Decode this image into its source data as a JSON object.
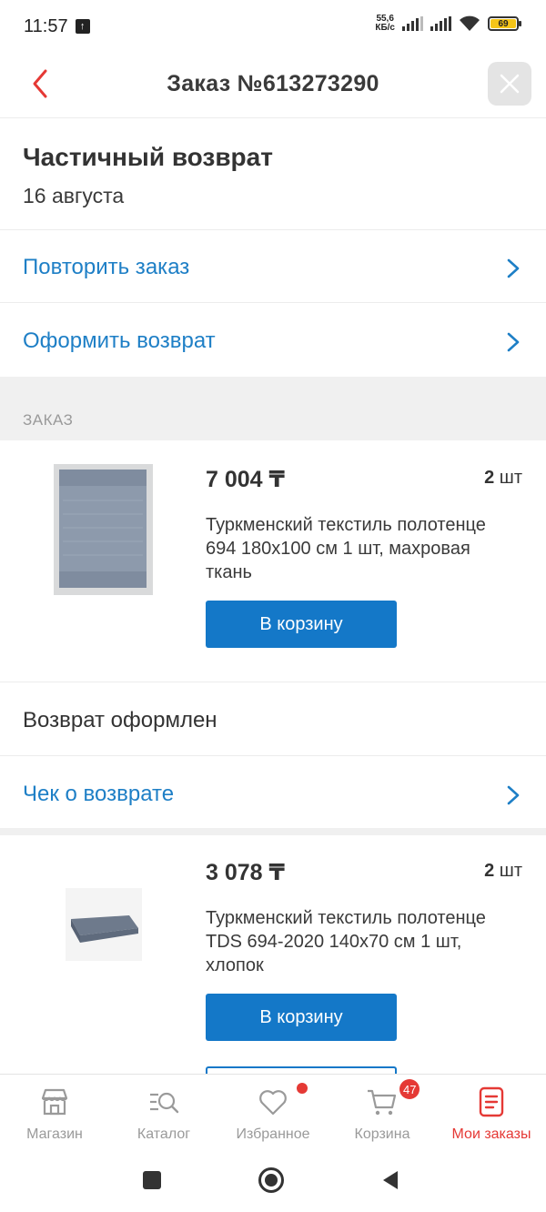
{
  "status_bar": {
    "time": "11:57",
    "speed_value": "55,6",
    "speed_unit": "КБ/с",
    "battery": "69"
  },
  "header": {
    "title": "Заказ №613273290"
  },
  "order_status": {
    "title": "Частичный возврат",
    "date": "16 августа"
  },
  "actions": {
    "repeat": "Повторить заказ",
    "return": "Оформить возврат"
  },
  "section": {
    "label": "ЗАКАЗ"
  },
  "items": [
    {
      "price": "7 004 ₸",
      "qty": "2",
      "qty_unit": "шт",
      "title": "Туркменский текстиль полотенце 694 180х100 см 1 шт, махровая ткань",
      "button": "В корзину"
    },
    {
      "price": "3 078 ₸",
      "qty": "2",
      "qty_unit": "шт",
      "title": "Туркменский текстиль полотенце TDS 694-2020 140x70 см 1 шт, хлопок",
      "button": "В корзину"
    }
  ],
  "return_info": {
    "status": "Возврат оформлен",
    "receipt": "Чек о возврате"
  },
  "bottom_nav": [
    {
      "label": "Магазин",
      "icon": "store-icon"
    },
    {
      "label": "Каталог",
      "icon": "catalog-search-icon"
    },
    {
      "label": "Избранное",
      "icon": "heart-icon"
    },
    {
      "label": "Корзина",
      "icon": "cart-icon",
      "badge": "47"
    },
    {
      "label": "Мои заказы",
      "icon": "orders-icon",
      "active": true
    }
  ],
  "colors": {
    "accent_blue": "#1478c8",
    "link_blue": "#1e7fc6",
    "active_red": "#e53935"
  }
}
